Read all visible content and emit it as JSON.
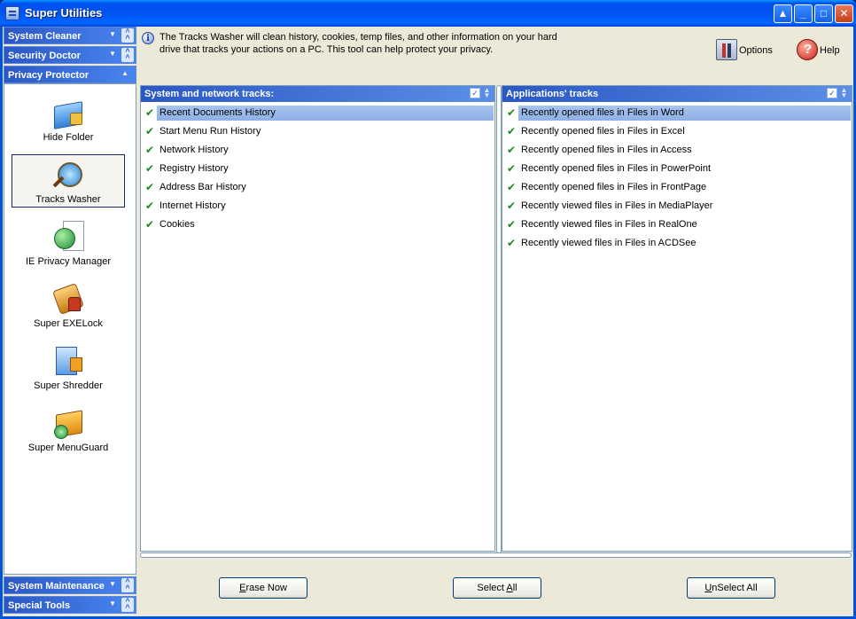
{
  "window": {
    "title": "Super Utilities"
  },
  "sidebar": {
    "headers": [
      {
        "label": "System Cleaner"
      },
      {
        "label": "Security Doctor"
      },
      {
        "label": "Privacy Protector"
      }
    ],
    "bottom_headers": [
      {
        "label": "System Maintenance"
      },
      {
        "label": "Special Tools"
      }
    ],
    "tools": [
      {
        "label": "Hide Folder",
        "icon": "hide-folder-icon"
      },
      {
        "label": "Tracks Washer",
        "icon": "tracks-washer-icon",
        "selected": true
      },
      {
        "label": "IE Privacy Manager",
        "icon": "ie-privacy-icon"
      },
      {
        "label": "Super EXELock",
        "icon": "exelock-icon"
      },
      {
        "label": "Super Shredder",
        "icon": "shredder-icon"
      },
      {
        "label": "Super MenuGuard",
        "icon": "menuguard-icon"
      }
    ]
  },
  "info": {
    "text": "The Tracks Washer will clean history, cookies, temp files, and other information on your hard drive that tracks your actions on a PC. This tool can help protect your privacy."
  },
  "toolbar": {
    "options_label": "Options",
    "help_label": "Help"
  },
  "left_panel": {
    "title": "System and network tracks:",
    "items": [
      "Recent Documents History",
      "Start Menu Run History",
      "Network History",
      "Registry History",
      "Address Bar History",
      "Internet History",
      "Cookies"
    ]
  },
  "right_panel": {
    "title": "Applications' tracks",
    "items": [
      "Recently opened files in Files in Word",
      "Recently opened files in Files in Excel",
      "Recently opened files in Files in Access",
      "Recently opened files in Files in PowerPoint",
      "Recently opened files in Files in FrontPage",
      "Recently viewed files in Files in MediaPlayer",
      "Recently viewed files in Files in RealOne",
      "Recently viewed files in Files in ACDSee"
    ]
  },
  "buttons": {
    "erase_first": "E",
    "erase_rest": "rase Now",
    "select_pre": "Select ",
    "select_ul": "A",
    "select_post": "ll",
    "unselect_ul": "U",
    "unselect_rest": "nSelect All"
  },
  "colors": {
    "header_blue": "#2b57c4",
    "check_green": "#1a8a1a",
    "selection": "#a8c4ef"
  }
}
